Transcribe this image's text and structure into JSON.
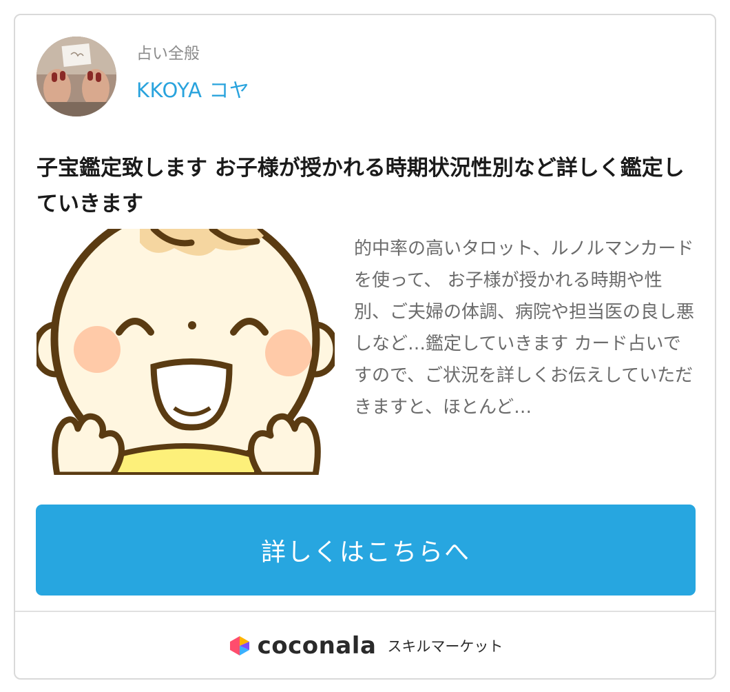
{
  "card": {
    "category": "占い全般",
    "seller_name": "KKOYA コヤ",
    "title": "子宝鑑定致します お子様が授かれる時期状況性別など詳しく鑑定していきます",
    "description": "的中率の高いタロット、ルノルマンカードを使って、 お子様が授かれる時期や性別、ご夫婦の体調、病院や担当医の良し悪しなど…鑑定していきます カード占いですので、ご状況を詳しくお伝えしていただきますと、ほとんど…",
    "cta_label": "詳しくはこちらへ"
  },
  "footer": {
    "brand_name": "coconala",
    "tagline": "スキルマーケット"
  },
  "colors": {
    "accent": "#27a6e0",
    "seller_link": "#29a3dd",
    "title_text": "#1a1a1a",
    "muted_text": "#8c8c8c",
    "border": "#d9d9d9"
  },
  "icons": {
    "avatar": "seller-avatar-image",
    "thumbnail": "baby-face-illustration",
    "logo": "coconala-logo-icon"
  }
}
